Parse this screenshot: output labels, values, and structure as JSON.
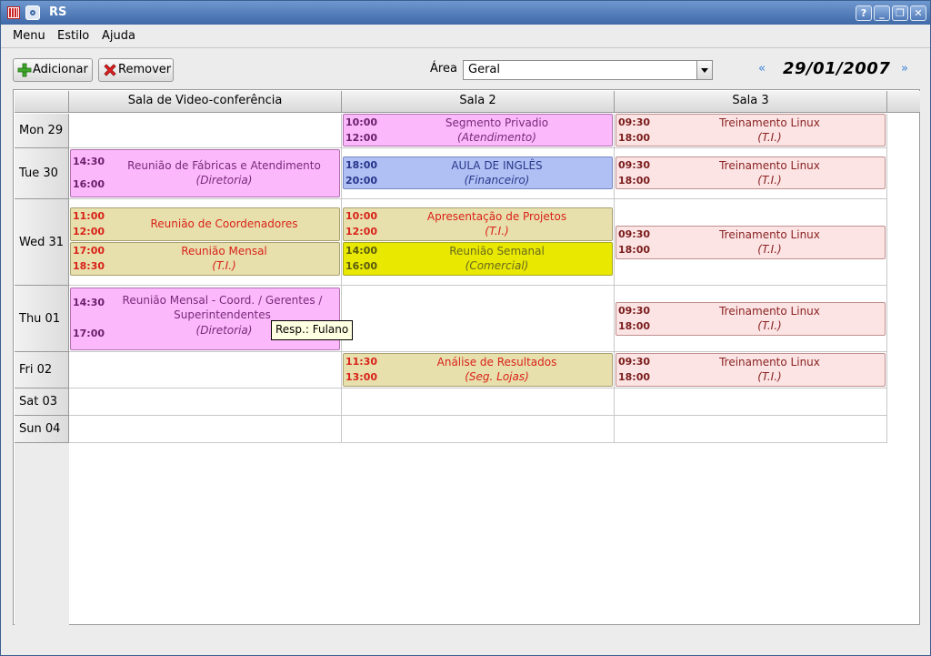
{
  "window": {
    "title": "RS",
    "controls": {
      "help": "?",
      "minimize": "_",
      "restore": "❐",
      "close": "✕"
    }
  },
  "menubar": {
    "items": [
      "Menu",
      "Estilo",
      "Ajuda"
    ]
  },
  "toolbar": {
    "add_label": "Adicionar",
    "remove_label": "Remover",
    "area_label": "Área",
    "area_value": "Geral",
    "prev_icon": "«",
    "next_icon": "»",
    "date": "29/01/2007"
  },
  "columns": [
    "Sala de Video-conferência",
    "Sala 2",
    "Sala 3"
  ],
  "days": [
    "Mon 29",
    "Tue 30",
    "Wed 31",
    "Thu 01",
    "Fri 02",
    "Sat 03",
    "Sun 04"
  ],
  "events": {
    "mon_sala2": {
      "start": "10:00",
      "end": "12:00",
      "title": "Segmento Privadio",
      "dept": "(Atendimento)"
    },
    "mon_sala3": {
      "start": "09:30",
      "end": "18:00",
      "title": "Treinamento Linux",
      "dept": "(T.I.)"
    },
    "tue_video": {
      "start": "14:30",
      "end": "16:00",
      "title": "Reunião de Fábricas e Atendimento",
      "dept": "(Diretoria)"
    },
    "tue_sala2": {
      "start": "18:00",
      "end": "20:00",
      "title": "AULA DE INGLÊS",
      "dept": "(Financeiro)"
    },
    "tue_sala3": {
      "start": "09:30",
      "end": "18:00",
      "title": "Treinamento Linux",
      "dept": "(T.I.)"
    },
    "wed_video_a": {
      "start": "11:00",
      "end": "12:00",
      "title": "Reunião de Coordenadores",
      "dept": ""
    },
    "wed_video_b": {
      "start": "17:00",
      "end": "18:30",
      "title": "Reunião Mensal",
      "dept": "(T.I.)"
    },
    "wed_sala2_a": {
      "start": "10:00",
      "end": "12:00",
      "title": "Apresentação de Projetos",
      "dept": "(T.I.)"
    },
    "wed_sala2_b": {
      "start": "14:00",
      "end": "16:00",
      "title": "Reunião Semanal",
      "dept": "(Comercial)"
    },
    "wed_sala3": {
      "start": "09:30",
      "end": "18:00",
      "title": "Treinamento Linux",
      "dept": "(T.I.)"
    },
    "thu_video": {
      "start": "14:30",
      "end": "17:00",
      "title": "Reunião Mensal - Coord. / Gerentes / Superintendentes",
      "dept": "(Diretoria)"
    },
    "thu_sala3": {
      "start": "09:30",
      "end": "18:00",
      "title": "Treinamento Linux",
      "dept": "(T.I.)"
    },
    "fri_sala2": {
      "start": "11:30",
      "end": "13:00",
      "title": "Análise de Resultados",
      "dept": "(Seg. Lojas)"
    },
    "fri_sala3": {
      "start": "09:30",
      "end": "18:00",
      "title": "Treinamento Linux",
      "dept": "(T.I.)"
    }
  },
  "tooltip": "Resp.: Fulano",
  "colors": {
    "pink": "#fbb8fb",
    "blue": "#b0bff4",
    "rose": "#fce4e4",
    "khaki": "#e8e0ac",
    "yellow": "#e8e800",
    "titlebar": "#3f6aa8"
  }
}
